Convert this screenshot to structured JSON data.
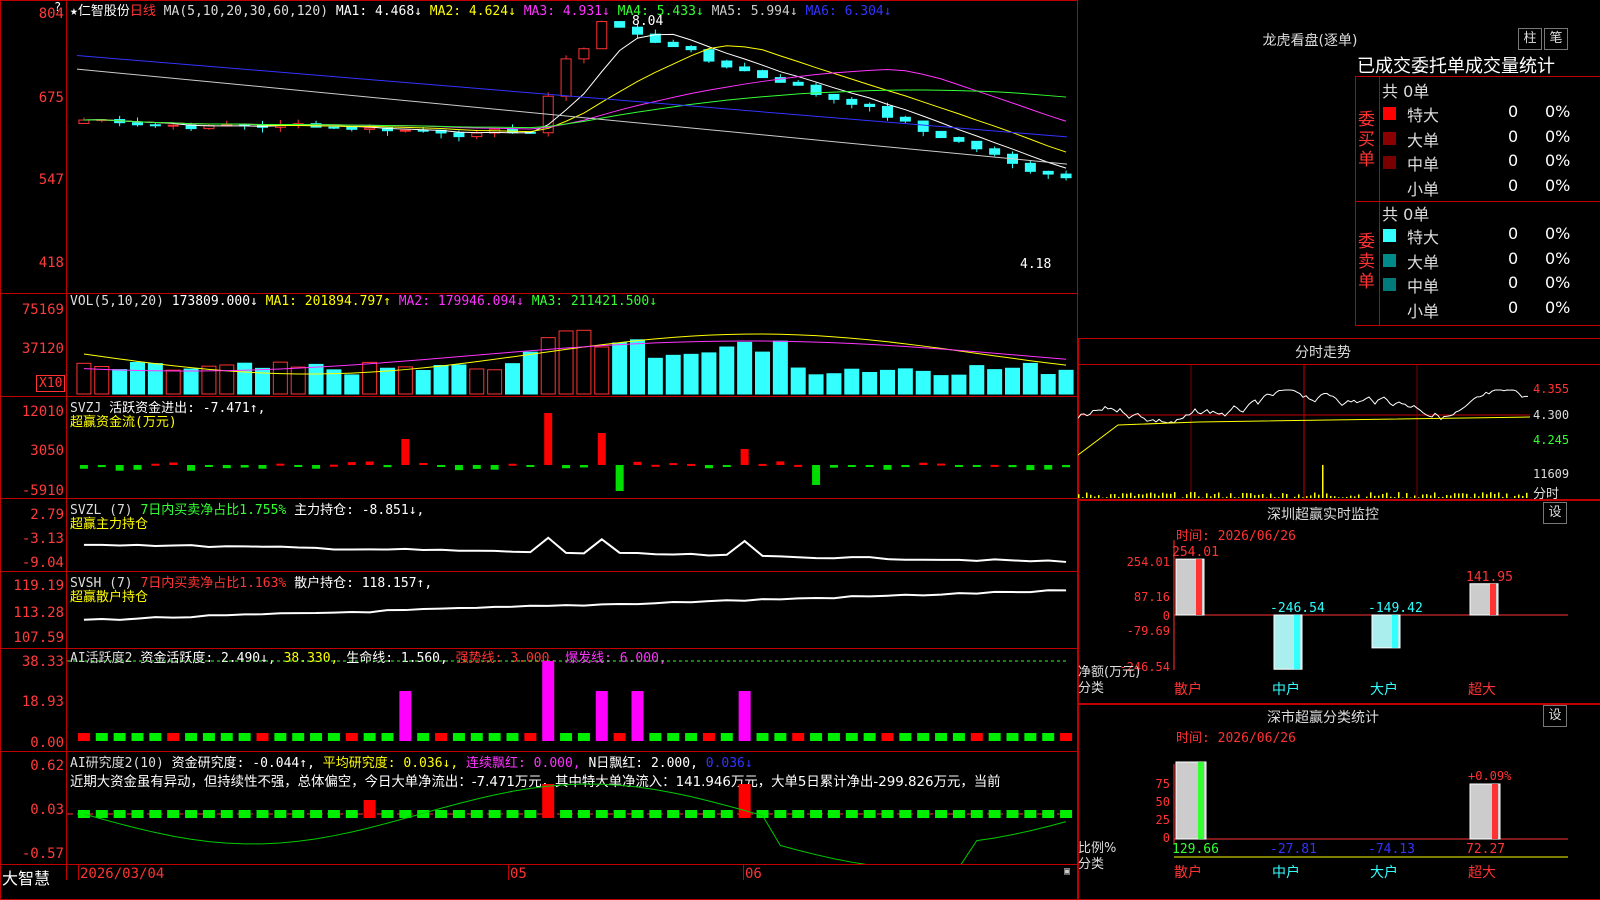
{
  "stock": {
    "title": "★仁智股份",
    "period": "日线"
  },
  "ma_header": {
    "label": "MA(5,10,20,30,60,120)",
    "ma1": "MA1: 4.468↓",
    "ma2": "MA2: 4.624↓",
    "ma3": "MA3: 4.931↓",
    "ma4": "MA4: 5.433↓",
    "ma5": "MA5: 5.994↓",
    "ma6": "MA6: 6.304↓"
  },
  "main_axis": [
    "804",
    "675",
    "547",
    "418"
  ],
  "price_marks": {
    "high": "8.04",
    "low": "4.18"
  },
  "vol_header": {
    "label": "VOL(5,10,20)",
    "v": "173809.000↓",
    "ma1": "MA1: 201894.797↑",
    "ma2": "MA2: 179946.094↓",
    "ma3": "MA3: 211421.500↓"
  },
  "vol_axis": [
    "75169",
    "37120"
  ],
  "vol_unit": "X10",
  "svzj": {
    "line1_a": "SVZJ",
    "line1_b": "活跃资金进出: -7.471↑,",
    "line2": "超赢资金流(万元)",
    "axis": [
      "12010",
      "3050",
      "-5910"
    ]
  },
  "svzl": {
    "line1_a": "SVZL (7)",
    "line1_b": "7日内买卖净占比1.755%",
    "line1_c": "主力持仓: -8.851↓,",
    "line2": "超赢主力持仓",
    "axis": [
      "2.79",
      "-3.13",
      "-9.04"
    ]
  },
  "svsh": {
    "line1_a": "SVSH (7)",
    "line1_b": "7日内买卖净占比1.163%",
    "line1_c": "散户持仓: 118.157↑,",
    "line2": "超赢散户持仓",
    "axis": [
      "119.19",
      "113.28",
      "107.59"
    ]
  },
  "ai1": {
    "a": "AI活跃度2",
    "b": "资金活跃度: 2.490↓,",
    "c": "38.330,",
    "d": "生命线: 1.560,",
    "e": "强势线: 3.000,",
    "f": "爆发线: 6.000,",
    "axis": [
      "38.33",
      "18.93",
      "0.00"
    ]
  },
  "ai2": {
    "a": "AI研究度2(10)",
    "b": "资金研究度: -0.044↑,",
    "c": "平均研究度: 0.036↓,",
    "d": "连续飘红: 0.000,",
    "e": "N日飘红: 2.000,",
    "f": "0.036↓",
    "desc": "近期大资金虽有异动，但持续性不强，总体偏空，今日大单净流出：-7.471万元，其中特大单净流入：141.946万元，大单5日累计净出-299.826万元，当前",
    "axis": [
      "0.62",
      "0.03",
      "-0.57"
    ]
  },
  "bottom": {
    "logo": "大智慧",
    "d1": "2026/03/04",
    "d2": "05",
    "d3": "06"
  },
  "lhb": {
    "title": "龙虎看盘(逐单)",
    "btn1": "柱",
    "btn2": "笔",
    "head": "已成交委托单成交量统计",
    "buy_label": "委买单",
    "sell_label": "委卖单",
    "buy_total": "共 0单",
    "sell_total": "共 0单",
    "buy": [
      {
        "name": "特大",
        "n": "0",
        "p": "0%",
        "color": "#ff0000"
      },
      {
        "name": "大单",
        "n": "0",
        "p": "0%",
        "color": "#8b0000"
      },
      {
        "name": "中单",
        "n": "0",
        "p": "0%",
        "color": "#7a0000"
      },
      {
        "name": "小单",
        "n": "0",
        "p": "0%",
        "color": ""
      }
    ],
    "sell": [
      {
        "name": "特大",
        "n": "0",
        "p": "0%",
        "color": "#33ffff"
      },
      {
        "name": "大单",
        "n": "0",
        "p": "0%",
        "color": "#008b8b"
      },
      {
        "name": "中单",
        "n": "0",
        "p": "0%",
        "color": "#007a7a"
      },
      {
        "name": "小单",
        "n": "0",
        "p": "0%",
        "color": ""
      }
    ]
  },
  "intraday": {
    "title": "分时走势",
    "axis": [
      "4.355",
      "4.300",
      "4.245"
    ],
    "vol_axis": "11609",
    "vol_label": "分时"
  },
  "monitor": {
    "title": "深圳超赢实时监控",
    "set": "设",
    "time": "时间: 2026/06/26",
    "axis": [
      "254.01",
      "87.16",
      "0",
      "-79.69",
      "-246.54"
    ],
    "unit": "净额(万元)",
    "cat": "分类",
    "bars": [
      {
        "name": "散户",
        "value": 254.01,
        "label": "254.01"
      },
      {
        "name": "中户",
        "value": -246.54,
        "label": "-246.54"
      },
      {
        "name": "大户",
        "value": -149.42,
        "label": "-149.42"
      },
      {
        "name": "超大",
        "value": 141.95,
        "label": "141.95"
      }
    ]
  },
  "classify": {
    "title": "深市超赢分类统计",
    "set": "设",
    "time": "时间: 2026/06/26",
    "axis": [
      "75",
      "50",
      "25",
      "0"
    ],
    "unit": "比例%",
    "cat": "分类",
    "pct_label": "+0.09%",
    "bars": [
      {
        "name": "散户",
        "value": 129.66,
        "label": "129.66"
      },
      {
        "name": "中户",
        "value": -27.81,
        "label": "-27.81"
      },
      {
        "name": "大户",
        "value": -74.13,
        "label": "-74.13"
      },
      {
        "name": "超大",
        "value": 72.27,
        "label": "72.27"
      }
    ]
  }
}
